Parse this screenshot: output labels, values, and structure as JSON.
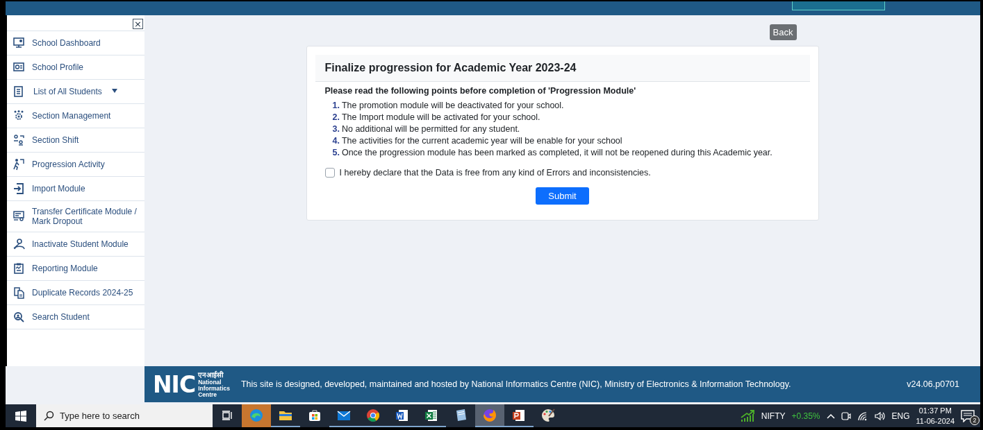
{
  "sidebar": {
    "close": "×",
    "items": [
      {
        "label": "School Dashboard",
        "has_dropdown": false
      },
      {
        "label": "School Profile",
        "has_dropdown": false
      },
      {
        "label": "List of All Students",
        "has_dropdown": true
      },
      {
        "label": "Section Management",
        "has_dropdown": false
      },
      {
        "label": "Section Shift",
        "has_dropdown": false
      },
      {
        "label": "Progression Activity",
        "has_dropdown": false
      },
      {
        "label": "Import Module",
        "has_dropdown": false
      },
      {
        "label": "Transfer Certificate Module / Mark Dropout",
        "has_dropdown": false
      },
      {
        "label": "Inactivate Student Module",
        "has_dropdown": false
      },
      {
        "label": "Reporting Module",
        "has_dropdown": false
      },
      {
        "label": "Duplicate Records 2024-25",
        "has_dropdown": false
      },
      {
        "label": "Search Student",
        "has_dropdown": false
      }
    ]
  },
  "back_button": "Back",
  "card": {
    "title": "Finalize progression for Academic Year 2023-24",
    "intro": "Please read the following points before completion of 'Progression Module'",
    "points": [
      {
        "number": "1.",
        "text": "The promotion module will be deactivated for your school."
      },
      {
        "number": "2.",
        "text": "The Import module will be activated for your school."
      },
      {
        "number": "3.",
        "text": "No additional will be permitted for any student."
      },
      {
        "number": "4.",
        "text": "The activities for the current academic year will be enable for your school"
      },
      {
        "number": "5.",
        "text": "Once the progression module has been marked as completed, it will not be reopened during this Academic year."
      }
    ],
    "declaration": {
      "label": "I hereby declare that the Data is free from any kind of Errors and inconsistencies.",
      "checked": false
    },
    "submit": "Submit"
  },
  "footer": {
    "logo": {
      "mark": "NIC",
      "hindi": "एनआईसी",
      "name": [
        "National",
        "Informatics",
        "Centre"
      ]
    },
    "text": "This site is designed, developed, maintained and hosted by National Informatics Centre (NIC), Ministry of Electronics & Information Technology.",
    "version": "v24.06.p0701"
  },
  "taskbar": {
    "search_placeholder": "Type here to search",
    "apps": [
      {
        "open": false,
        "attention": true,
        "selected": false
      },
      {
        "open": true,
        "attention": false,
        "selected": false
      },
      {
        "open": false,
        "attention": false,
        "selected": false
      },
      {
        "open": true,
        "attention": false,
        "selected": false
      },
      {
        "open": true,
        "attention": false,
        "selected": false
      },
      {
        "open": true,
        "attention": false,
        "selected": false
      },
      {
        "open": true,
        "attention": false,
        "selected": false
      },
      {
        "open": false,
        "attention": false,
        "selected": false
      },
      {
        "open": true,
        "attention": false,
        "selected": true
      },
      {
        "open": true,
        "attention": false,
        "selected": false
      },
      {
        "open": false,
        "attention": false,
        "selected": false
      }
    ],
    "ticker": {
      "name": "NIFTY",
      "change": "+0.35%"
    },
    "language": "ENG",
    "time": "01:37 PM",
    "date": "11-06-2024",
    "notifications": "2"
  }
}
